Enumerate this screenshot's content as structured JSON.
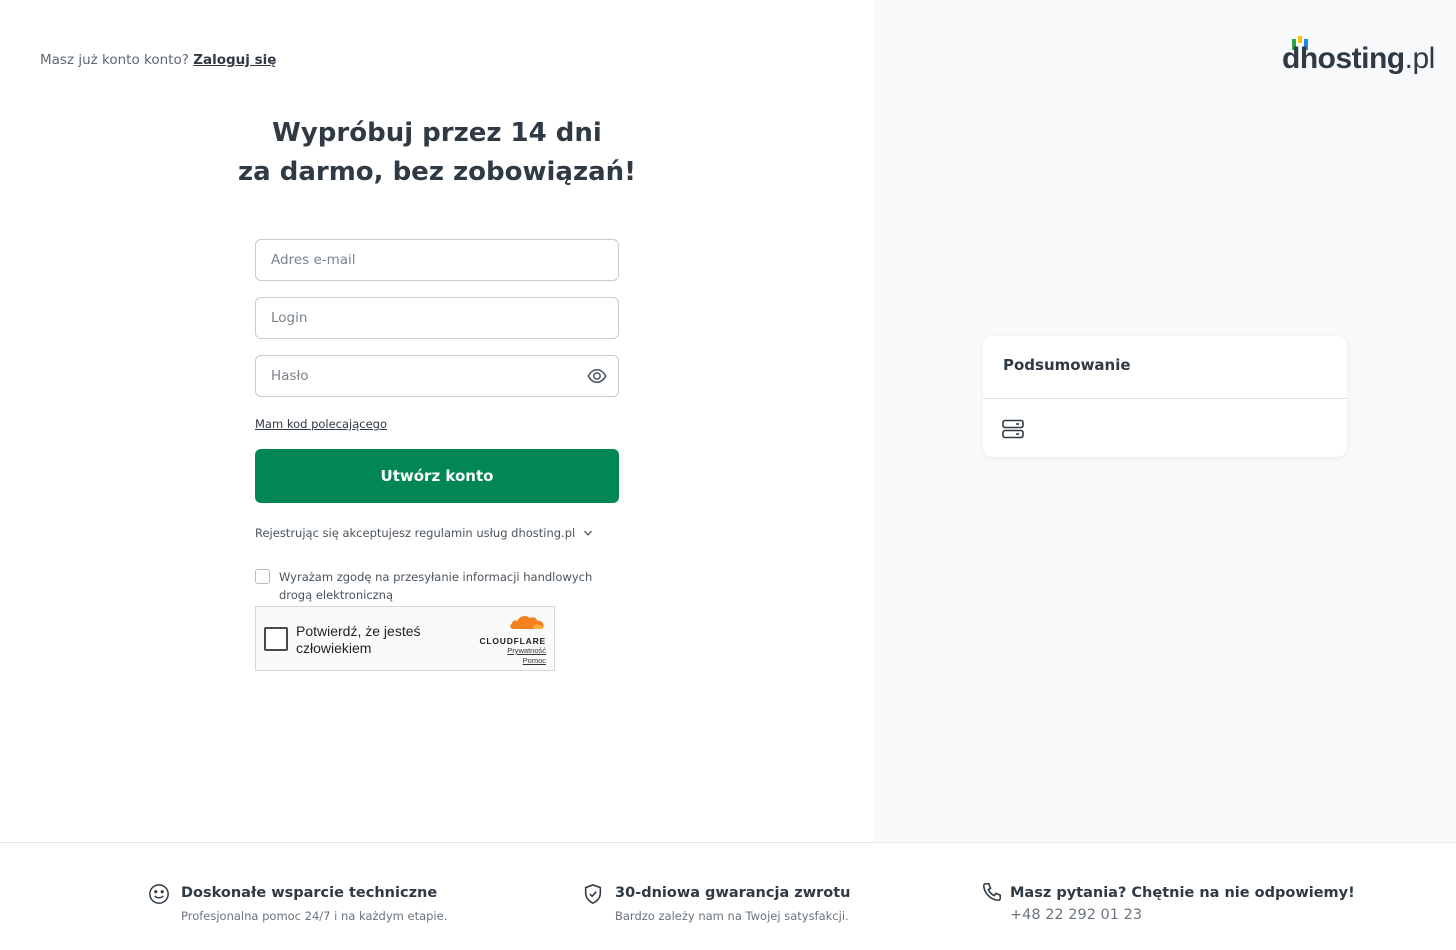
{
  "header": {
    "login_prompt": "Masz już konto konto?",
    "login_link": "Zaloguj się"
  },
  "logo": {
    "text": "dhosting",
    "tld": ".pl",
    "bar_colors": [
      "#27a844",
      "#ffc107",
      "#1e88e5"
    ]
  },
  "headline": {
    "line1": "Wypróbuj przez 14 dni",
    "line2": "za darmo, bez zobowiązań!"
  },
  "form": {
    "email_placeholder": "Adres e-mail",
    "login_placeholder": "Login",
    "password_placeholder": "Hasło",
    "password_toggle_icon": "eye-icon",
    "referral_link": "Mam kod polecającego",
    "submit_label": "Utwórz konto",
    "terms_text": "Rejestrując się akceptujesz regulamin usług dhosting.pl",
    "consent_text": "Wyrażam zgodę na przesyłanie informacji handlowych drogą elektroniczną"
  },
  "captcha": {
    "label": "Potwierdź, że jesteś człowiekiem",
    "brand": "CLOUDFLARE",
    "privacy_link": "Prywatność",
    "help_link": "Pomoc"
  },
  "summary": {
    "title": "Podsumowanie",
    "icon": "server-icon"
  },
  "footer": {
    "features": [
      {
        "icon": "smile-icon",
        "title": "Doskonałe wsparcie techniczne",
        "subtitle": "Profesjonalna pomoc 24/7 i na każdym etapie."
      },
      {
        "icon": "shield-check-icon",
        "title": "30-dniowa gwarancja zwrotu",
        "subtitle": "Bardzo zależy nam na Twojej satysfakcji."
      },
      {
        "icon": "phone-icon",
        "title": "Masz pytania? Chętnie na nie odpowiemy!",
        "phone": "+48 22 292 01 23"
      }
    ]
  },
  "colors": {
    "primary": "#018754",
    "text": "#2f3a44",
    "right_panel_bg": "#f8f9fa",
    "cloudflare_orange": "#f48120"
  }
}
